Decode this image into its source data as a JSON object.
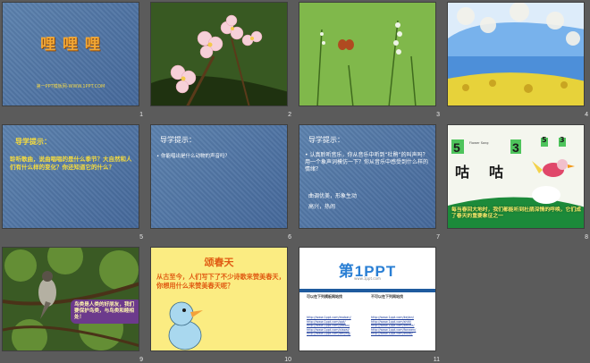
{
  "slides": [
    {
      "number": "1",
      "title": "哩 哩 哩",
      "footer": "第一PPT模板网-WWW.1PPT.COM"
    },
    {
      "number": "2"
    },
    {
      "number": "3"
    },
    {
      "number": "4"
    },
    {
      "number": "5",
      "heading": "导学提示：",
      "body": "聆听歌曲，说曲唱唱的是什么季节？大自然和人们有什么样的变化？你还知道它的什么？"
    },
    {
      "number": "6",
      "heading": "导学提示：",
      "bullet": "你能唱出是什么动物的声音吗？"
    },
    {
      "number": "7",
      "heading": "导学提示：",
      "bullet": "认真聆听音乐，你从音乐中听到“杜鹃”的叫声吗？用一个象声词模仿一下？你从音乐中感受到什么样的情绪？",
      "line1": "曲调优美，形象生动",
      "line2": "高兴，热闹"
    },
    {
      "number": "8",
      "digit_left": "5",
      "digit_right": "3",
      "digit_small_left": "5",
      "digit_small_right": "3",
      "label_top": "Flower Song",
      "char_left": "咕",
      "char_right": "咕",
      "caption": "每当春回大地时，我们都能听到杜鹃深情的呼唤，它们成了春天的重要象征之一"
    },
    {
      "number": "9",
      "bubble": "鸟类是人类的好朋友，我们要保护鸟类，与鸟类和睦相处！"
    },
    {
      "number": "10",
      "title": "颂春天",
      "body": "从古至今，人们写下了不少诗歌来赞美春天，你想用什么来赞美春天呢？"
    },
    {
      "number": "11",
      "logo_main": "第1PPT",
      "logo_sub": "www.1ppt.com",
      "col_left_title": "可以在下列模板网站找",
      "col_right_title": "不可以在下列网站找",
      "col_left_links": [
        "http://www.1ppt.com/moban/",
        "http://www.1ppt.com/ppt/",
        "http://www.1ppt.com/jiaoan/",
        "http://www.1ppt.com/xiazai/",
        "http://www.1ppt.com/beijing/"
      ],
      "col_right_links": [
        "http://www.1ppt.com/kejian/",
        "http://www.1ppt.com/shiti/",
        "http://www.1ppt.com/article/",
        "http://www.1ppt.com/fanwen/",
        "http://www.1ppt.com/ziliao/"
      ]
    }
  ],
  "colors": {
    "slide_blue": "#4e74a0",
    "title_orange": "#f3a733",
    "heading_yellow": "#f7dc3c",
    "background": "#5b5b5b"
  }
}
